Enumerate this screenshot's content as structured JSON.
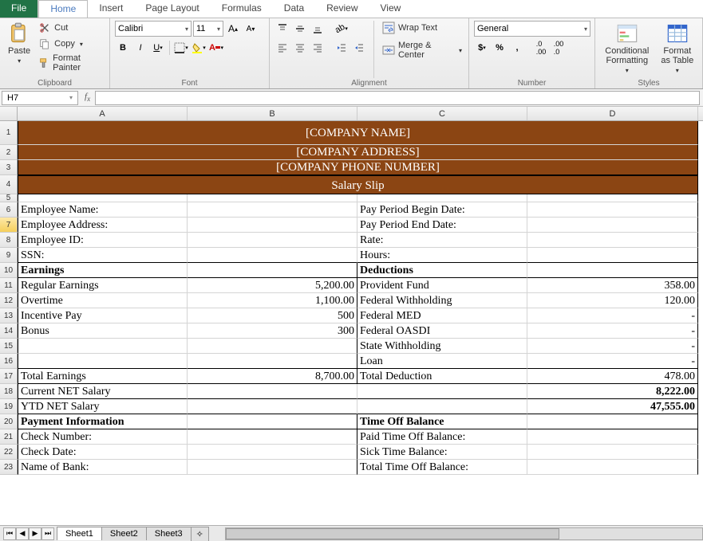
{
  "tabs": {
    "file": "File",
    "home": "Home",
    "insert": "Insert",
    "page_layout": "Page Layout",
    "formulas": "Formulas",
    "data": "Data",
    "review": "Review",
    "view": "View"
  },
  "clipboard": {
    "paste": "Paste",
    "cut": "Cut",
    "copy": "Copy",
    "format_painter": "Format Painter",
    "label": "Clipboard"
  },
  "font": {
    "name": "Calibri",
    "size": "11",
    "label": "Font"
  },
  "alignment": {
    "wrap": "Wrap Text",
    "merge": "Merge & Center",
    "label": "Alignment"
  },
  "number": {
    "format": "General",
    "label": "Number"
  },
  "styles": {
    "cond": "Conditional Formatting",
    "table": "Format as Table",
    "label": "Styles"
  },
  "namebox": "H7",
  "cols": [
    "A",
    "B",
    "C",
    "D"
  ],
  "sheet": {
    "r1": "[COMPANY NAME]",
    "r2": "[COMPANY ADDRESS]",
    "r3": "[COMPANY PHONE NUMBER]",
    "r4": "Salary Slip",
    "r6a": "Employee Name:",
    "r6c": "Pay Period Begin Date:",
    "r7a": "Employee Address:",
    "r7c": "Pay Period End Date:",
    "r8a": "Employee ID:",
    "r8c": "Rate:",
    "r9a": "SSN:",
    "r9c": "Hours:",
    "r10a": "Earnings",
    "r10c": "Deductions",
    "r11a": "Regular Earnings",
    "r11b": "5,200.00",
    "r11c": "Provident Fund",
    "r11d": "358.00",
    "r12a": "Overtime",
    "r12b": "1,100.00",
    "r12c": "Federal Withholding",
    "r12d": "120.00",
    "r13a": "Incentive Pay",
    "r13b": "500",
    "r13c": "Federal MED",
    "r13d": "-",
    "r14a": "Bonus",
    "r14b": "300",
    "r14c": "Federal OASDI",
    "r14d": "-",
    "r15c": "State Withholding",
    "r15d": "-",
    "r16c": "Loan",
    "r16d": "-",
    "r17a": "Total Earnings",
    "r17b": "8,700.00",
    "r17c": "Total Deduction",
    "r17d": "478.00",
    "r18a": "Current NET Salary",
    "r18d": "8,222.00",
    "r19a": "YTD NET Salary",
    "r19d": "47,555.00",
    "r20a": "Payment Information",
    "r20c": "Time Off Balance",
    "r21a": "Check  Number:",
    "r21c": "Paid Time Off Balance:",
    "r22a": "Check Date:",
    "r22c": "Sick Time Balance:",
    "r23a": "Name of Bank:",
    "r23c": "Total Time Off Balance:"
  },
  "sheets": {
    "s1": "Sheet1",
    "s2": "Sheet2",
    "s3": "Sheet3"
  }
}
